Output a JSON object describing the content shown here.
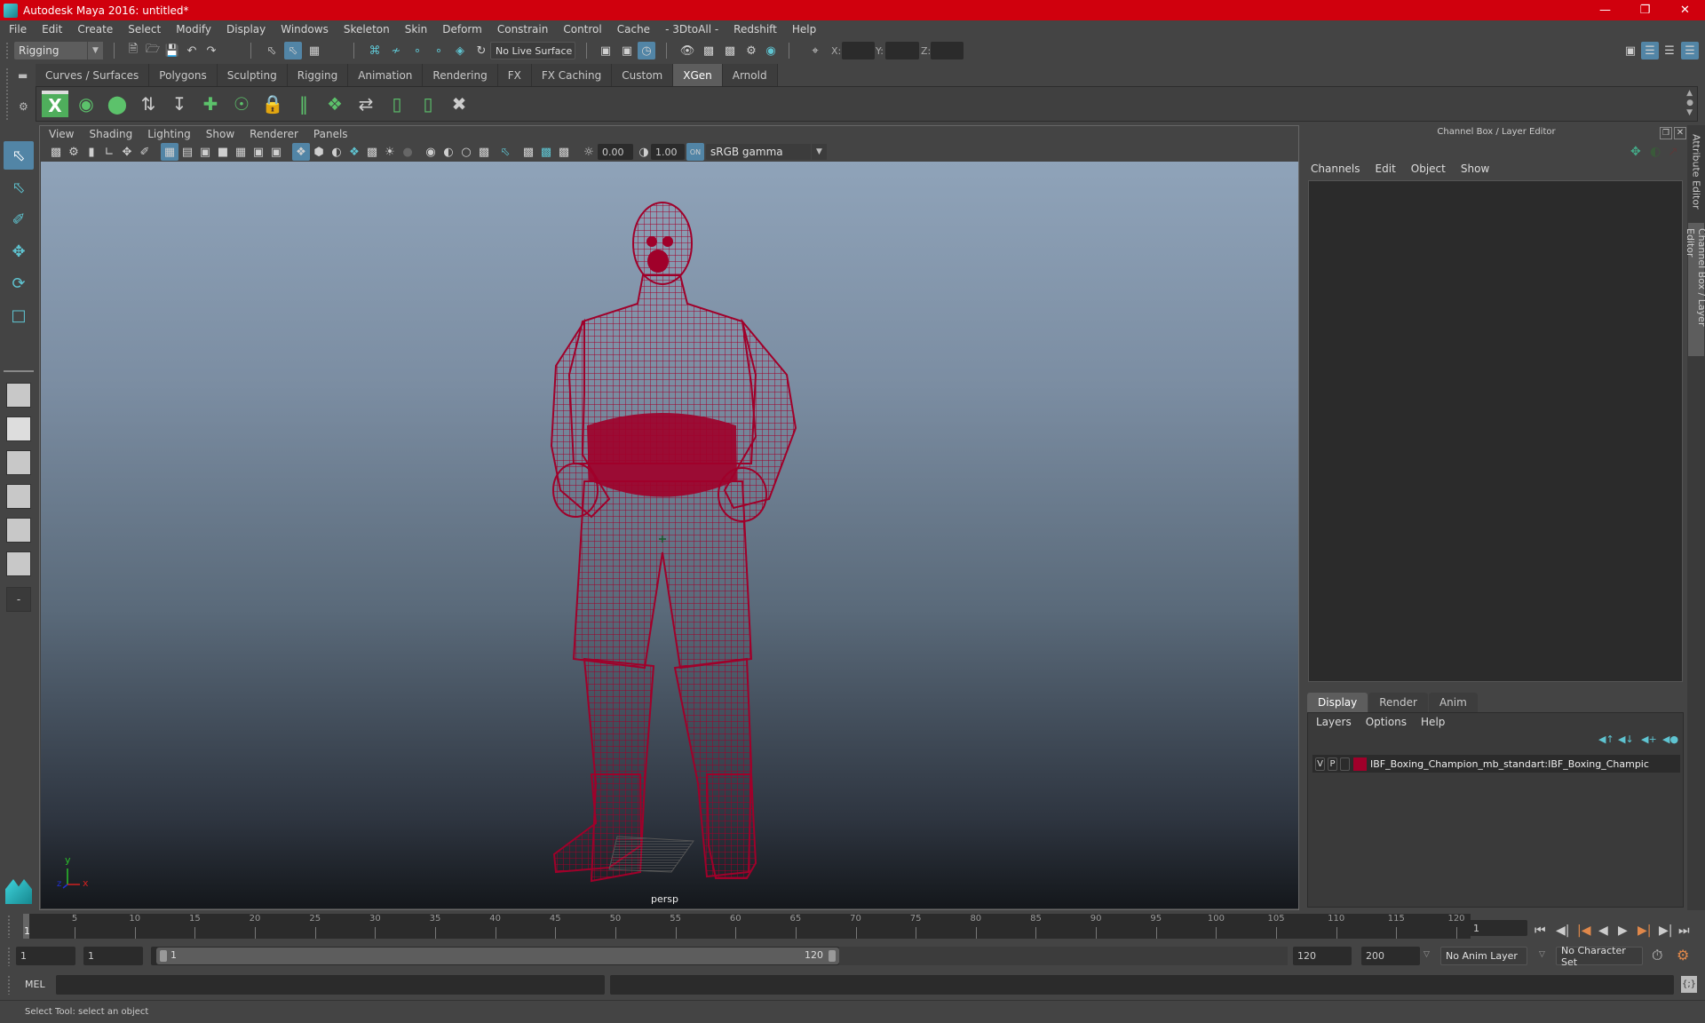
{
  "window": {
    "title": "Autodesk Maya 2016: untitled*",
    "controls": [
      "minimize",
      "restore",
      "close"
    ]
  },
  "menubar": [
    "File",
    "Edit",
    "Create",
    "Select",
    "Modify",
    "Display",
    "Windows",
    "Skeleton",
    "Skin",
    "Deform",
    "Constrain",
    "Control",
    "Cache",
    "- 3DtoAll -",
    "Redshift",
    "Help"
  ],
  "statusline": {
    "menuset": "Rigging",
    "live_surface": "No Live Surface",
    "xyz_labels": [
      "X:",
      "Y:",
      "Z:"
    ],
    "xyz_values": [
      "",
      "",
      ""
    ]
  },
  "shelf": {
    "tabs": [
      "Curves / Surfaces",
      "Polygons",
      "Sculpting",
      "Rigging",
      "Animation",
      "Rendering",
      "FX",
      "FX Caching",
      "Custom",
      "XGen",
      "Arnold"
    ],
    "active_tab": "XGen",
    "icons": [
      "xgen-window-icon",
      "xgen-preview-icon",
      "xgen-clear-preview-icon",
      "add-guides-icon",
      "sculpt-guides-icon",
      "add-guide-icon",
      "select-guide-icon",
      "lock-guide-icon",
      "guide-length-icon",
      "rebuild-guides-icon",
      "flip-guides-icon",
      "select-guides-icon",
      "guides-bounding-icon",
      "delete-guides-icon"
    ]
  },
  "viewport": {
    "menu": [
      "View",
      "Shading",
      "Lighting",
      "Show",
      "Renderer",
      "Panels"
    ],
    "exposure": "0.00",
    "gamma": "1.00",
    "color_space": "sRGB gamma",
    "camera_label": "persp",
    "axis_labels": {
      "x": "x",
      "y": "y",
      "z": "z"
    },
    "wireframe_color": "#a0002a"
  },
  "channel_box": {
    "title": "Channel Box / Layer Editor",
    "menu": [
      "Channels",
      "Edit",
      "Object",
      "Show"
    ]
  },
  "layer_editor": {
    "tabs": [
      "Display",
      "Render",
      "Anim"
    ],
    "active_tab": "Display",
    "menu": [
      "Layers",
      "Options",
      "Help"
    ],
    "layers": [
      {
        "visible": "V",
        "playback": "P",
        "color": "#a0002a",
        "name": "IBF_Boxing_Champion_mb_standart:IBF_Boxing_Champic"
      }
    ]
  },
  "side_tabs": [
    "Attribute Editor",
    "Channel Box / Layer Editor"
  ],
  "timeline": {
    "ticks": [
      5,
      10,
      15,
      20,
      25,
      30,
      35,
      40,
      45,
      50,
      55,
      60,
      65,
      70,
      75,
      80,
      85,
      90,
      95,
      100,
      105,
      110,
      115,
      120
    ],
    "start": 1,
    "end": 120,
    "current_frame_marker": "1",
    "current_frame": "1"
  },
  "range": {
    "start_time": "1",
    "playback_start": "1",
    "range_start_label": "1",
    "range_end_label": "120",
    "playback_end": "120",
    "end_time": "200",
    "anim_layer": "No Anim Layer",
    "character_set": "No Character Set"
  },
  "command_line": {
    "language": "MEL",
    "input": "",
    "result": ""
  },
  "help_line": "Select Tool: select an object"
}
